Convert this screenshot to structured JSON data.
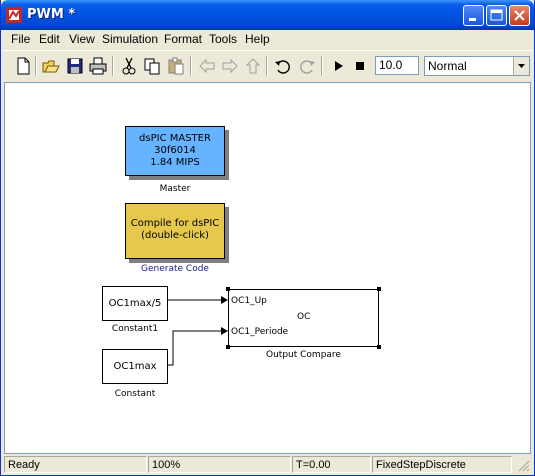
{
  "window": {
    "title": "PWM *"
  },
  "menu": {
    "items": [
      "File",
      "Edit",
      "View",
      "Simulation",
      "Format",
      "Tools",
      "Help"
    ]
  },
  "toolbar": {
    "icons": [
      "new-icon",
      "open-icon",
      "save-icon",
      "print-icon",
      "cut-icon",
      "copy-icon",
      "paste-icon",
      "back-icon",
      "forward-icon",
      "up-icon",
      "undo-icon",
      "redo-icon",
      "start-simulation-icon",
      "stop-simulation-icon"
    ],
    "stop_time": "10.0",
    "sim_mode": "Normal"
  },
  "blocks": {
    "master": {
      "lines": [
        "dsPIC MASTER",
        "30f6014",
        "1.84 MIPS"
      ],
      "label": "Master",
      "color": "#66b3ff"
    },
    "generate": {
      "lines": [
        "Compile for dsPIC",
        "(double-click)"
      ],
      "label": "Generate Code",
      "color": "#e6c84d"
    },
    "constant1": {
      "value": "OC1max/5",
      "label": "Constant1"
    },
    "constant": {
      "value": "OC1max",
      "label": "Constant"
    },
    "output_compare": {
      "port1": "OC1_Up",
      "port2": "OC1_Periode",
      "name": "OC",
      "label": "Output Compare"
    }
  },
  "status": {
    "ready": "Ready",
    "zoom": "100%",
    "time": "T=0.00",
    "solver": "FixedStepDiscrete"
  }
}
